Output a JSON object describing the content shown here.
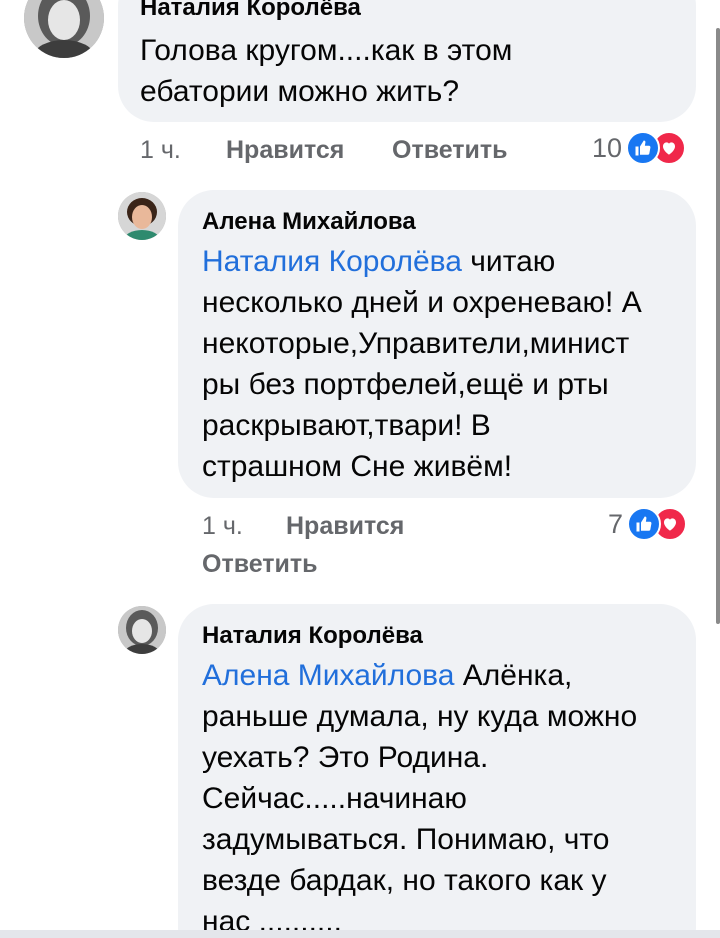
{
  "comments": [
    {
      "author": "Наталия Королёва",
      "lines": [
        "Голова кругом....как в этом",
        "ебатории можно жить?"
      ],
      "time": "1 ч.",
      "like_label": "Нравится",
      "reply_label": "Ответить",
      "reaction_count": "10",
      "reaction_icons": [
        "like-icon",
        "love-icon"
      ]
    },
    {
      "author": "Алена Михайлова",
      "mention": "Наталия Королёва",
      "first_line_rest": " читаю",
      "lines": [
        "несколько дней и охреневаю! А",
        "некоторые,Управители,минист",
        "ры без портфелей,ещё и рты",
        "раскрывают,твари! В",
        "страшном Сне живём!"
      ],
      "time": "1 ч.",
      "like_label": "Нравится",
      "reply_label": "Ответить",
      "reaction_count": "7",
      "reaction_icons": [
        "like-icon",
        "love-icon"
      ]
    },
    {
      "author": "Наталия Королёва",
      "mention": "Алена Михайлова",
      "first_line_rest": " Алёнка,",
      "lines": [
        "раньше думала, ну куда можно",
        "уехать? Это Родина.",
        "Сейчас.....начинаю",
        "задумываться. Понимаю, что",
        "везде бардак, но такого как у",
        "нас .........."
      ]
    }
  ],
  "colors": {
    "bubble": "#f0f2f5",
    "mention": "#216fdb",
    "meta": "#65676b",
    "like": "#1877f2",
    "love": "#f0284a"
  }
}
